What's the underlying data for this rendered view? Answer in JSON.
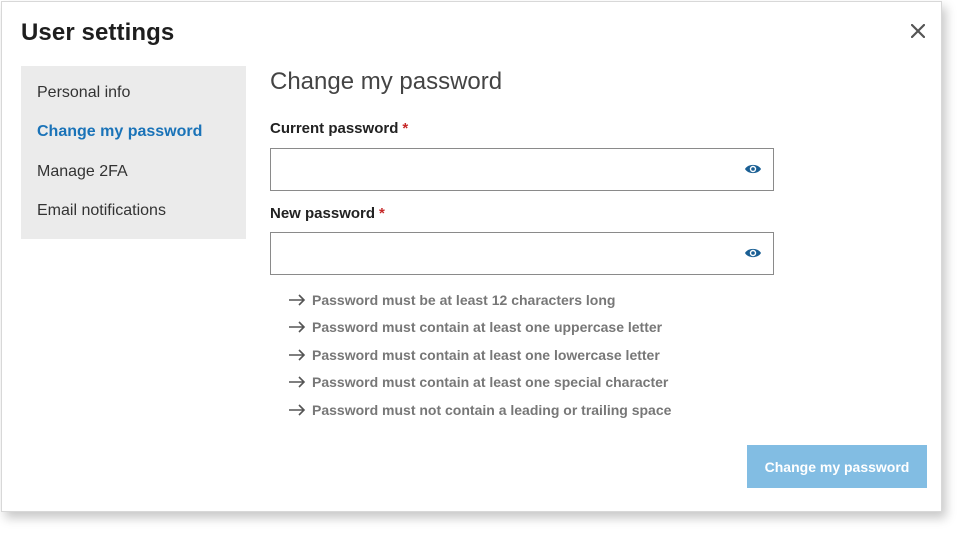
{
  "dialog": {
    "title": "User settings",
    "close_icon": "close-icon"
  },
  "sidebar": {
    "items": [
      {
        "label": "Personal info",
        "active": false
      },
      {
        "label": "Change my password",
        "active": true
      },
      {
        "label": "Manage 2FA",
        "active": false
      },
      {
        "label": "Email notifications",
        "active": false
      }
    ]
  },
  "main": {
    "section_title": "Change my password",
    "current_password": {
      "label": "Current password",
      "required_mark": "*",
      "value": "",
      "icon": "eye-icon"
    },
    "new_password": {
      "label": "New password",
      "required_mark": "*",
      "value": "",
      "icon": "eye-icon"
    },
    "rules": [
      "Password must be at least 12 characters long",
      "Password must contain at least one uppercase letter",
      "Password must contain at least one lowercase letter",
      "Password must contain at least one special character",
      "Password must not contain a leading or trailing space"
    ],
    "submit_label": "Change my password"
  },
  "colors": {
    "accent": "#1a73b8",
    "required": "#c62828",
    "submit_disabled": "#82bde3",
    "sidebar_bg": "#ebebeb"
  }
}
